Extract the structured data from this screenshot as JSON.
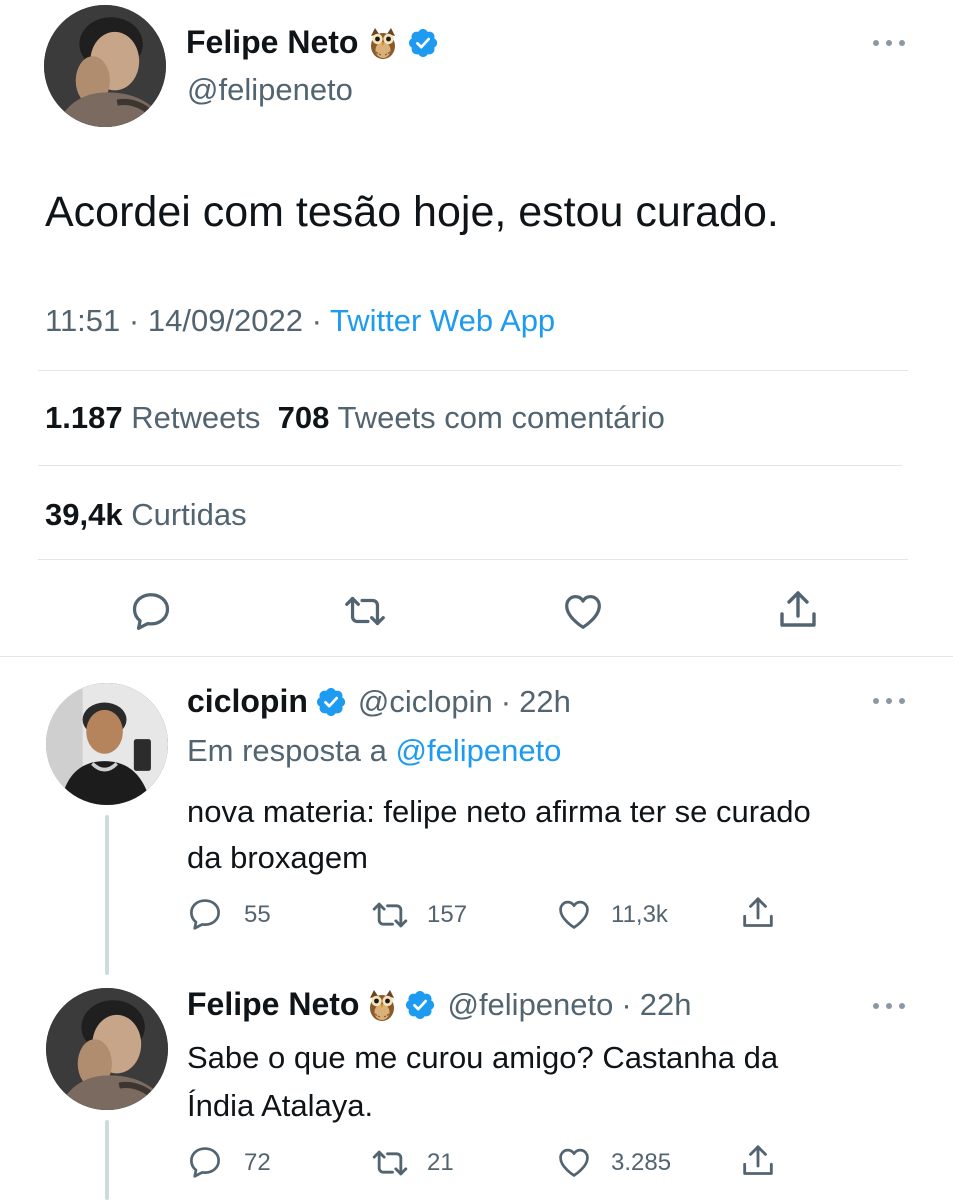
{
  "main_tweet": {
    "author_name": "Felipe Neto",
    "handle": "@felipeneto",
    "text": "Acordei com tesão hoje, estou curado.",
    "time": "11:51",
    "sep1": "·",
    "date": "14/09/2022",
    "sep2": "·",
    "source": "Twitter Web App",
    "retweets_count": "1.187",
    "retweets_label": "Retweets",
    "quotes_count": "708",
    "quotes_label": "Tweets com comentário",
    "likes_count": "39,4k",
    "likes_label": "Curtidas"
  },
  "replies": [
    {
      "author_name": "ciclopin",
      "handle": "@ciclopin",
      "sep": "·",
      "time": "22h",
      "in_reply_prefix": "Em resposta a",
      "in_reply_handle": "@felipeneto",
      "text_line1": "nova materia: felipe neto afirma ter se curado",
      "text_line2": "da broxagem",
      "reply_count": "55",
      "retweet_count": "157",
      "like_count": "11,3k"
    },
    {
      "author_name": "Felipe Neto",
      "handle": "@felipeneto",
      "sep": "·",
      "time": "22h",
      "text_line1": "Sabe o que me curou amigo? Castanha da",
      "text_line2": "Índia Atalaya.",
      "reply_count": "72",
      "retweet_count": "21",
      "like_count": "3.285"
    }
  ],
  "icons": [
    "owl-emoji-icon",
    "verified-badge-icon",
    "more-icon",
    "reply-icon",
    "retweet-icon",
    "like-icon",
    "share-icon"
  ],
  "colors": {
    "accent": "#1d9bf0",
    "text": "#0f1419",
    "secondary": "#536471",
    "divider": "#e1e6ea",
    "thread": "#cfd9de"
  }
}
